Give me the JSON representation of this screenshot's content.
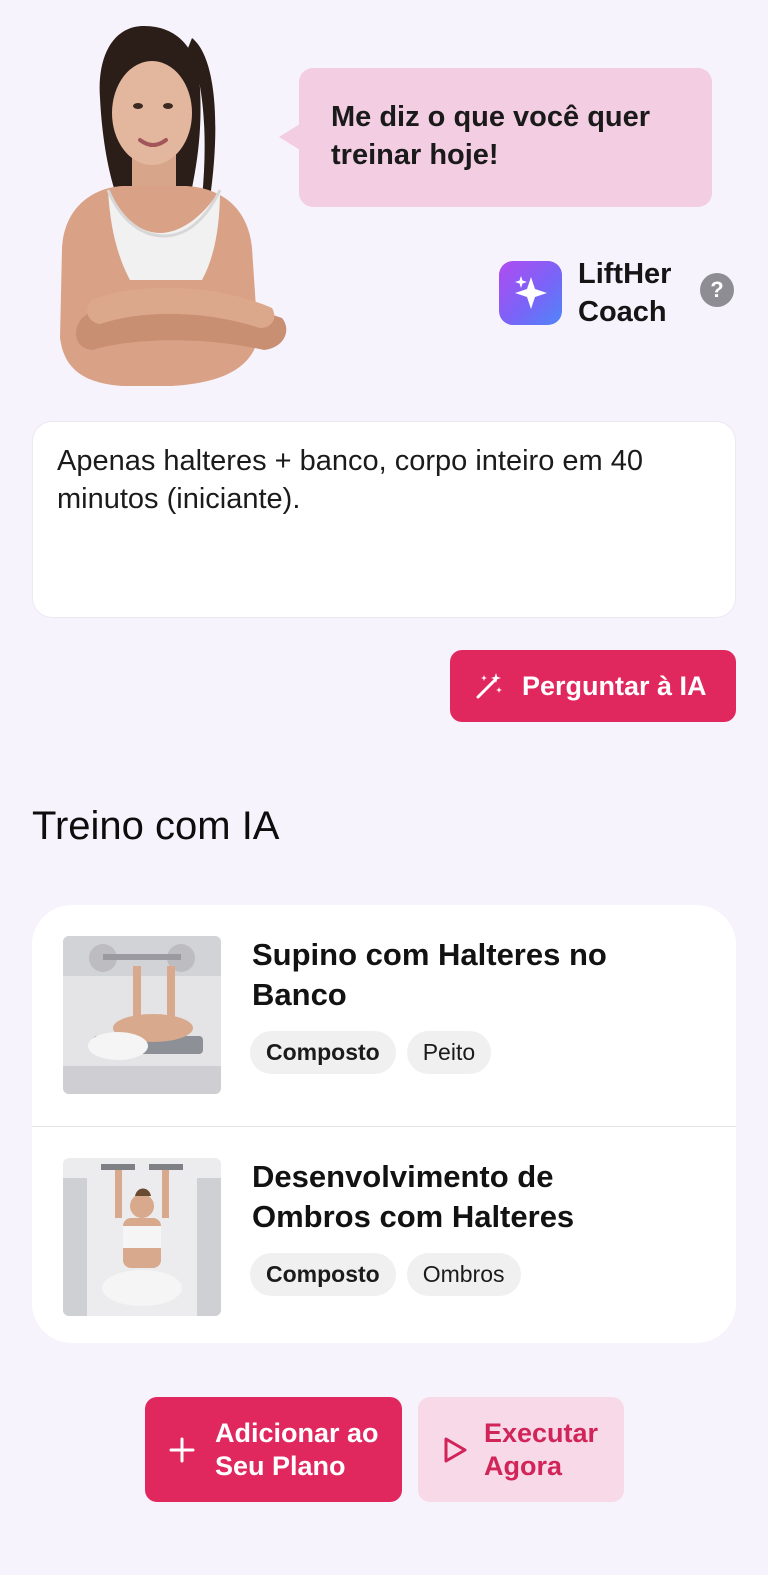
{
  "coach": {
    "speech": "Me diz o que você quer treinar hoje!",
    "name": "LiftHer Coach",
    "help_symbol": "?",
    "avatar_icon": "sparkles-icon"
  },
  "prompt": {
    "value": "Apenas halteres + banco, corpo inteiro em 40 minutos (iniciante)."
  },
  "ask_button": {
    "label": "Perguntar à IA",
    "icon": "magic-wand-icon"
  },
  "section": {
    "title": "Treino com IA"
  },
  "exercises": [
    {
      "title": "Supino com Halteres no Banco",
      "tags": [
        "Composto",
        "Peito"
      ]
    },
    {
      "title": "Desenvolvimento de Ombros com Halteres",
      "tags": [
        "Composto",
        "Ombros"
      ]
    }
  ],
  "actions": {
    "add_label": "Adicionar ao Seu Plano",
    "add_icon": "plus-icon",
    "run_label": "Executar Agora",
    "run_icon": "play-icon"
  },
  "colors": {
    "accent": "#e0275e",
    "accent_soft": "#f7d9e8",
    "bubble": "#f3cde2",
    "background": "#f7f3fc"
  }
}
